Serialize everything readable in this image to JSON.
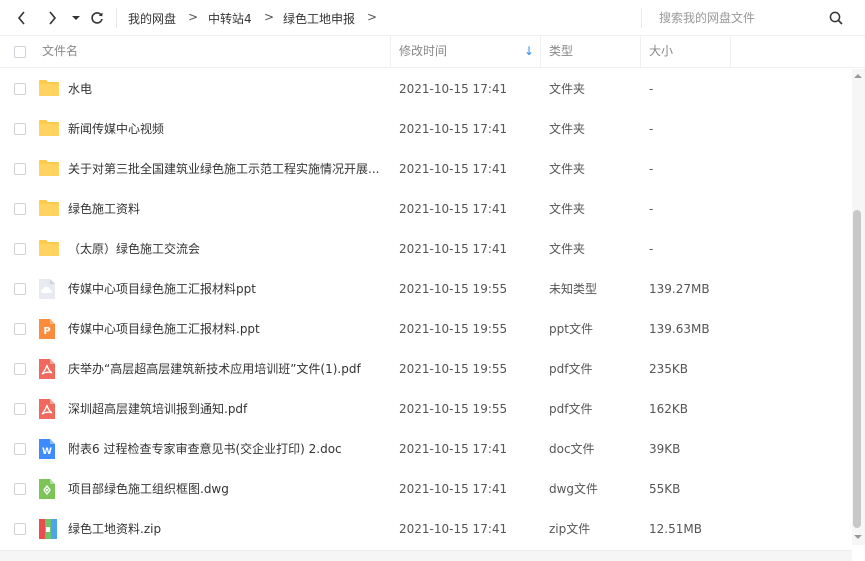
{
  "toolbar": {
    "breadcrumb": [
      "我的网盘",
      "中转站4",
      "绿色工地申报"
    ],
    "search_placeholder": "搜索我的网盘文件"
  },
  "columns": {
    "name": "文件名",
    "modified": "修改时间",
    "type": "类型",
    "size": "大小",
    "sort_indicator": "↓"
  },
  "files": [
    {
      "icon": "folder-icon",
      "name": "水电",
      "modified": "2021-10-15 17:41",
      "type": "文件夹",
      "size": "-"
    },
    {
      "icon": "folder-icon",
      "name": "新闻传媒中心视频",
      "modified": "2021-10-15 17:41",
      "type": "文件夹",
      "size": "-"
    },
    {
      "icon": "folder-icon",
      "name": "关于对第三批全国建筑业绿色施工示范工程实施情况开展...",
      "modified": "2021-10-15 17:41",
      "type": "文件夹",
      "size": "-"
    },
    {
      "icon": "folder-icon",
      "name": "绿色施工资料",
      "modified": "2021-10-15 17:41",
      "type": "文件夹",
      "size": "-"
    },
    {
      "icon": "folder-icon",
      "name": "（太原）绿色施工交流会",
      "modified": "2021-10-15 17:41",
      "type": "文件夹",
      "size": "-"
    },
    {
      "icon": "unknown-file-icon",
      "name": "传媒中心项目绿色施工汇报材料ppt",
      "modified": "2021-10-15 19:55",
      "type": "未知类型",
      "size": "139.27MB"
    },
    {
      "icon": "ppt-file-icon",
      "name": "传媒中心项目绿色施工汇报材料.ppt",
      "modified": "2021-10-15 19:55",
      "type": "ppt文件",
      "size": "139.63MB"
    },
    {
      "icon": "pdf-file-icon",
      "name": "庆举办“高层超高层建筑新技术应用培训班”文件(1).pdf",
      "modified": "2021-10-15 19:55",
      "type": "pdf文件",
      "size": "235KB"
    },
    {
      "icon": "pdf-file-icon",
      "name": "深圳超高层建筑培训报到通知.pdf",
      "modified": "2021-10-15 19:55",
      "type": "pdf文件",
      "size": "162KB"
    },
    {
      "icon": "doc-file-icon",
      "name": "附表6  过程检查专家审查意见书(交企业打印) 2.doc",
      "modified": "2021-10-15 17:41",
      "type": "doc文件",
      "size": "39KB"
    },
    {
      "icon": "dwg-file-icon",
      "name": "项目部绿色施工组织框图.dwg",
      "modified": "2021-10-15 17:41",
      "type": "dwg文件",
      "size": "55KB"
    },
    {
      "icon": "zip-file-icon",
      "name": "绿色工地资料.zip",
      "modified": "2021-10-15 17:41",
      "type": "zip文件",
      "size": "12.51MB"
    }
  ],
  "colors": {
    "folder": "#ffc94a",
    "pdf": "#f0695f",
    "ppt": "#fa8c3c",
    "doc": "#3d8bfd",
    "dwg": "#7cc35a",
    "sort_arrow": "#2e8fe8"
  }
}
